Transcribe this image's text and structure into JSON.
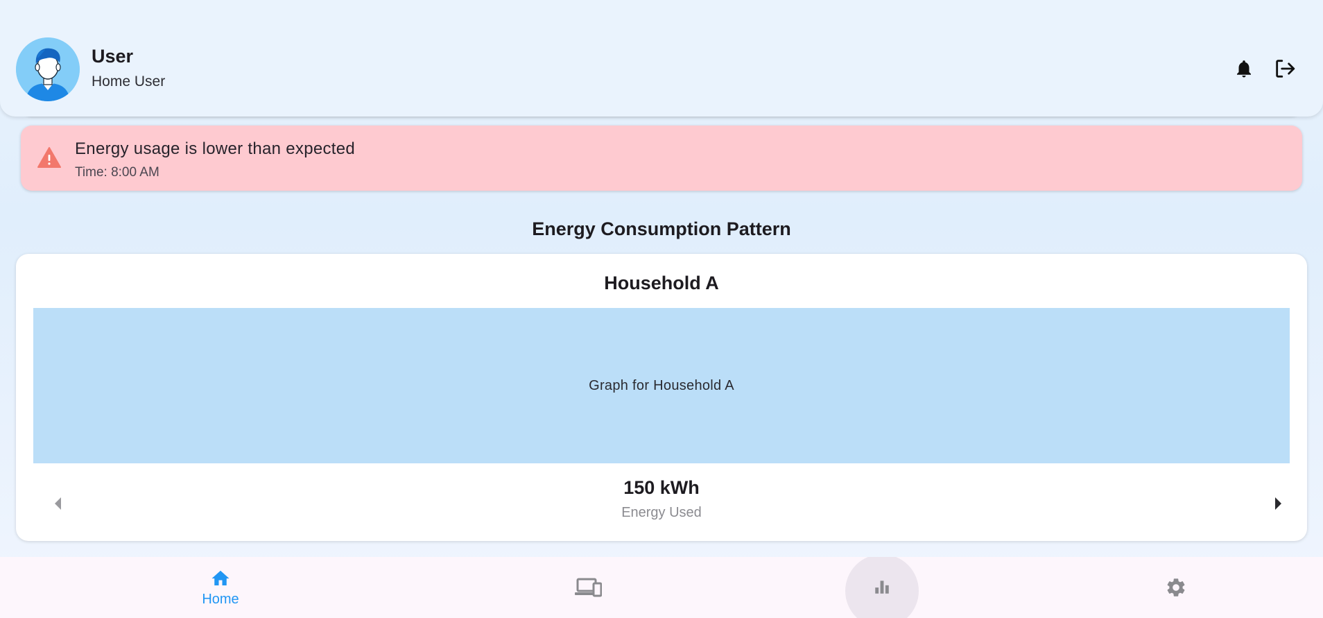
{
  "header": {
    "user_name": "User",
    "user_role": "Home User",
    "icons": {
      "avatar": "person-avatar-icon",
      "notifications": "bell-icon",
      "logout": "logout-icon"
    },
    "background": "#eaf3fd"
  },
  "alert": {
    "title": "Energy usage is lower than expected",
    "time": "Time: 8:00 AM",
    "icon": "warning-icon",
    "background": "#fecad0",
    "icon_color": "#f2786c"
  },
  "section": {
    "title": "Energy Consumption Pattern"
  },
  "household_card": {
    "name": "Household A",
    "graph_placeholder": "Graph for Household A",
    "graph_background": "#bbdef8",
    "energy_value": "150 kWh",
    "energy_caption": "Energy Used",
    "prev_icon": "caret-left-icon",
    "next_icon": "caret-right-icon"
  },
  "bottom_nav": {
    "items": [
      {
        "id": "home",
        "label": "Home",
        "icon": "home-icon",
        "active": true
      },
      {
        "id": "devices",
        "label": "",
        "icon": "devices-icon",
        "active": false
      },
      {
        "id": "stats",
        "label": "",
        "icon": "bar-chart-icon",
        "active": false,
        "hovered": true
      },
      {
        "id": "settings",
        "label": "",
        "icon": "gear-icon",
        "active": false
      }
    ],
    "active_color": "#2196f3",
    "inactive_color": "#8a8a8e"
  }
}
